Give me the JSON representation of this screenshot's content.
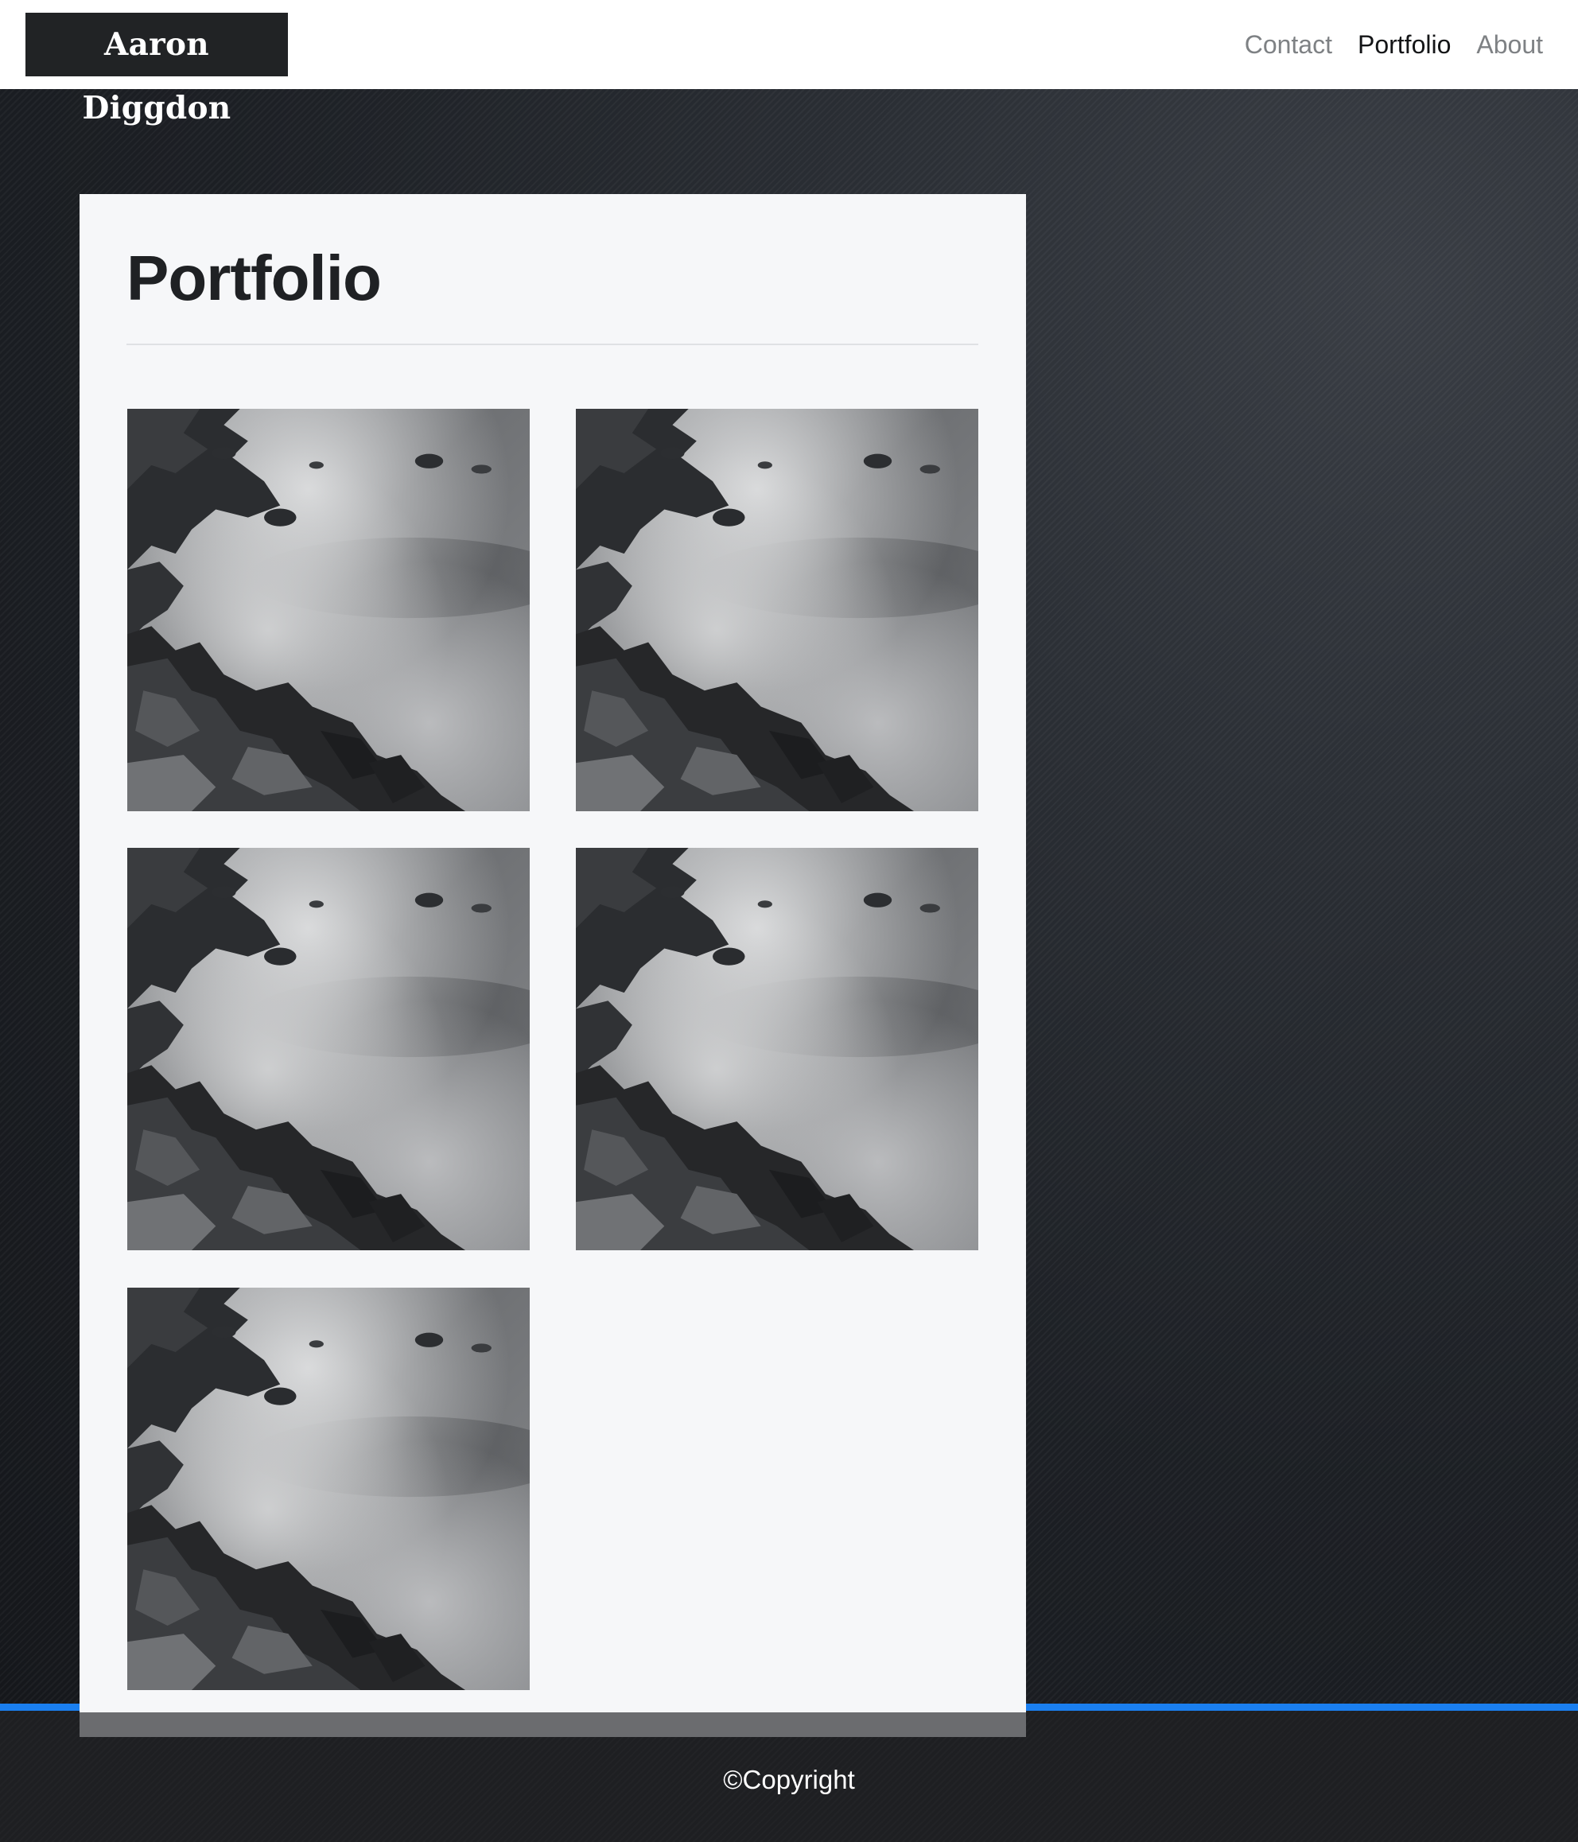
{
  "header": {
    "brand": "Aaron Diggdon",
    "nav": [
      {
        "label": "Contact",
        "active": false
      },
      {
        "label": "Portfolio",
        "active": true
      },
      {
        "label": "About",
        "active": false
      }
    ]
  },
  "main": {
    "title": "Portfolio",
    "gallery": [
      {
        "subject": "rocky-coast-photo"
      },
      {
        "subject": "rocky-coast-photo"
      },
      {
        "subject": "rocky-coast-photo"
      },
      {
        "subject": "rocky-coast-photo"
      },
      {
        "subject": "rocky-coast-photo"
      }
    ]
  },
  "footer": {
    "copyright": "©Copyright"
  },
  "colors": {
    "accent": "#1a7ff0",
    "card_background": "#f6f7f9",
    "brand_background": "#212325",
    "footer_background": "#1e1f22"
  }
}
